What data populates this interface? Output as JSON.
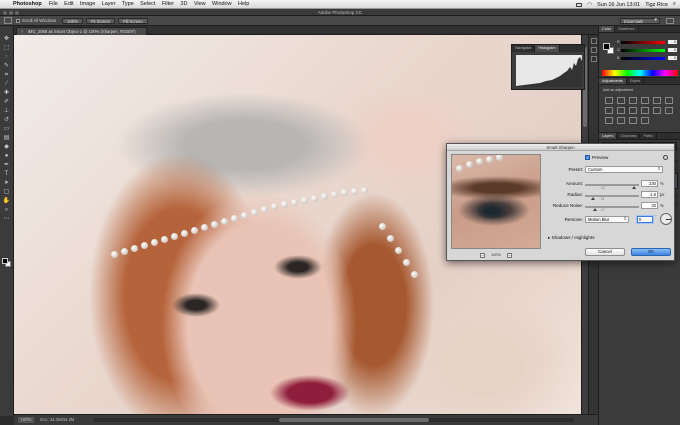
{
  "menubar": {
    "app_name": "Photoshop",
    "items": [
      "File",
      "Edit",
      "Image",
      "Layer",
      "Type",
      "Select",
      "Filter",
      "3D",
      "View",
      "Window",
      "Help"
    ],
    "clock": "Sun 16 Jun  13:01",
    "user": "Tigz Rice"
  },
  "window": {
    "title": "Adobe Photoshop CC"
  },
  "options_bar": {
    "scroll_all_label": "Scroll All Windows",
    "btn_100": "100%",
    "btn_fit": "Fit Screen",
    "btn_fill": "Fill Screen",
    "workspace": "Essentials"
  },
  "document": {
    "tab_title": "IMG_2068 as Smart Object-1 @ 100% (Sharpen, RGB/8*)",
    "zoom": "100%",
    "doc_info": "Doc: 34.3M/34.3M"
  },
  "histogram_panel": {
    "tab_navigator": "Navigator",
    "tab_histogram": "Histogram"
  },
  "right_panels": {
    "color_tab": "Color",
    "swatches_tab": "Swatches",
    "channels": [
      {
        "label": "R",
        "value": "0"
      },
      {
        "label": "G",
        "value": "0"
      },
      {
        "label": "B",
        "value": "0"
      }
    ],
    "adjustments_tab": "Adjustments",
    "styles_tab": "Styles",
    "adjustments_hint": "Add an adjustment",
    "layers_tab": "Layers",
    "channels_tab": "Channels",
    "paths_tab": "Paths"
  },
  "smart_sharpen": {
    "title": "Smart Sharpen",
    "preview_label": "Preview",
    "preview_zoom": "100%",
    "preset_label": "Preset:",
    "preset_value": "Custom",
    "amount_label": "Amount:",
    "amount_value": "230",
    "amount_unit": "%",
    "amount_tick": "12",
    "radius_label": "Radius:",
    "radius_value": "1.8",
    "radius_unit": "px",
    "radius_tick": "11",
    "noise_label": "Reduce Noise:",
    "noise_value": "20",
    "noise_unit": "%",
    "noise_tick": "17",
    "remove_label": "Remove:",
    "remove_value": "Motion Blur",
    "angle_value": "0",
    "angle_unit": "°",
    "shadows_label": "Shadows / Highlights",
    "cancel_label": "Cancel",
    "ok_label": "OK"
  }
}
